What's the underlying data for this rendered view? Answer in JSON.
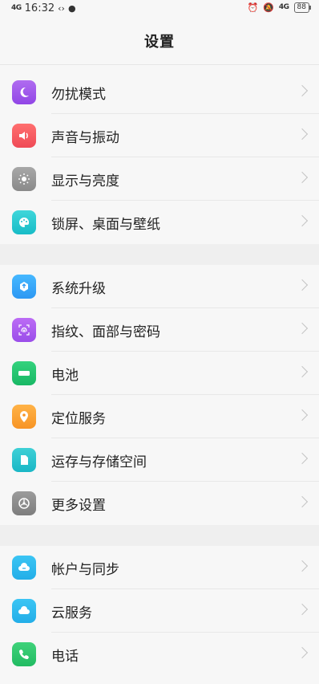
{
  "status": {
    "time": "16:32",
    "network": "4G",
    "battery": "88"
  },
  "header": {
    "title": "设置"
  },
  "groups": [
    {
      "items": [
        {
          "label": "勿扰模式",
          "icon": "moon-icon"
        },
        {
          "label": "声音与振动",
          "icon": "speaker-icon"
        },
        {
          "label": "显示与亮度",
          "icon": "sun-icon"
        },
        {
          "label": "锁屏、桌面与壁纸",
          "icon": "palette-icon"
        }
      ]
    },
    {
      "items": [
        {
          "label": "系统升级",
          "icon": "upgrade-icon"
        },
        {
          "label": "指纹、面部与密码",
          "icon": "fingerprint-icon"
        },
        {
          "label": "电池",
          "icon": "battery-icon"
        },
        {
          "label": "定位服务",
          "icon": "location-icon"
        },
        {
          "label": "运存与存储空间",
          "icon": "storage-icon"
        },
        {
          "label": "更多设置",
          "icon": "more-settings-icon"
        }
      ]
    },
    {
      "items": [
        {
          "label": "帐户与同步",
          "icon": "account-sync-icon"
        },
        {
          "label": "云服务",
          "icon": "cloud-icon"
        },
        {
          "label": "电话",
          "icon": "phone-icon"
        }
      ]
    }
  ]
}
